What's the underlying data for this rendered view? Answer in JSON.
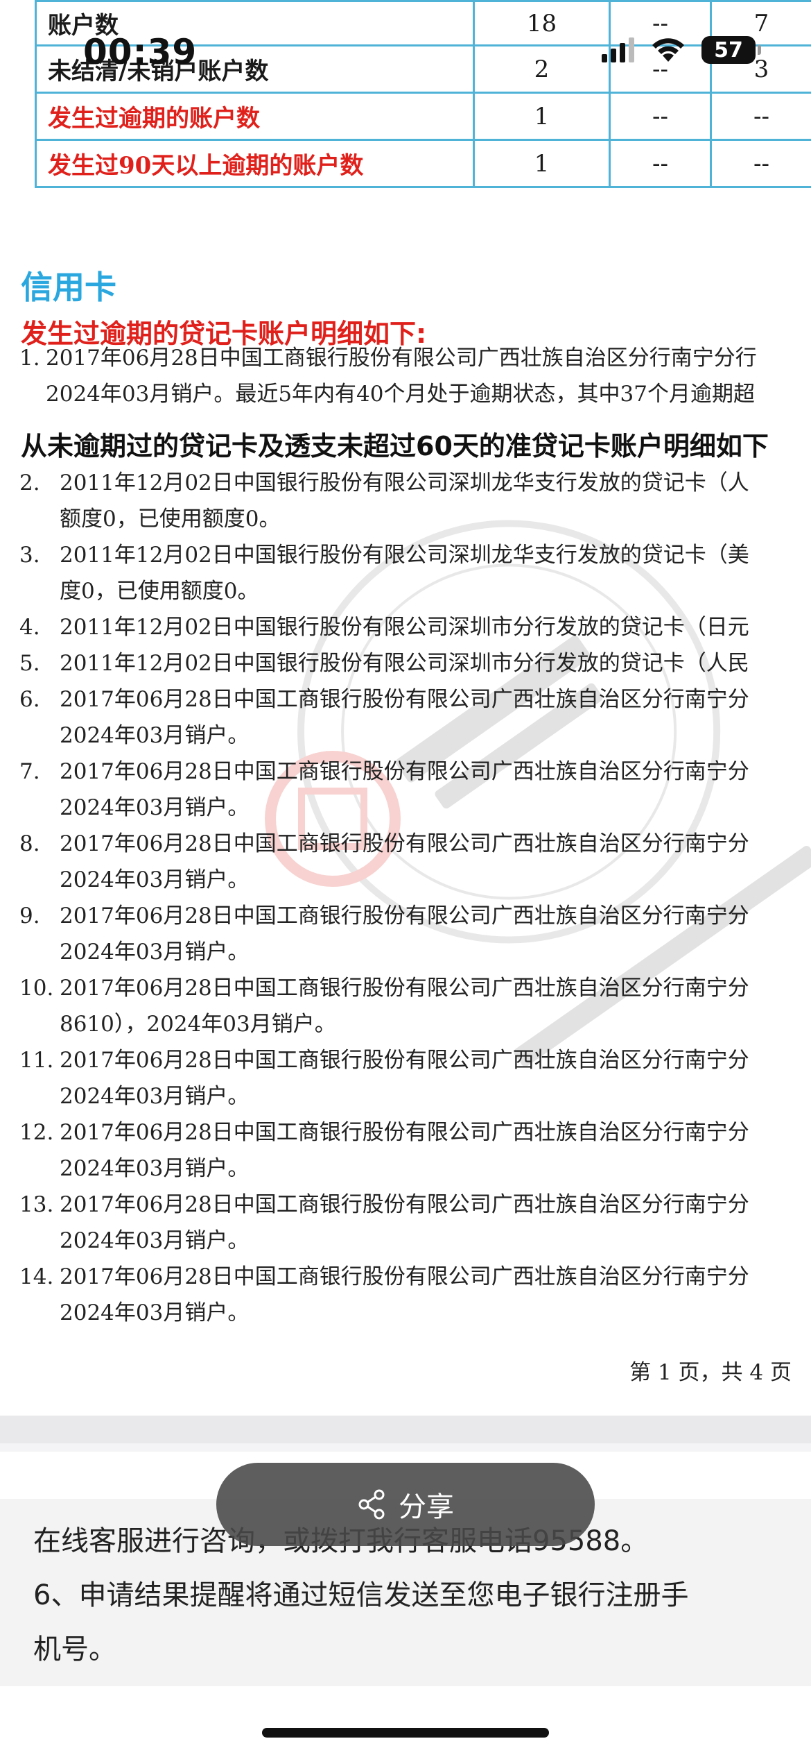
{
  "status_bar": {
    "time": "00:39",
    "battery": "57"
  },
  "summary_table": {
    "rows": [
      {
        "label": "账户数",
        "c1": "18",
        "c2": "--",
        "c3": "7",
        "red": false
      },
      {
        "label": "未结清/未销户账户数",
        "c1": "2",
        "c2": "--",
        "c3": "3",
        "red": false
      },
      {
        "label": "发生过逾期的账户数",
        "c1": "1",
        "c2": "--",
        "c3": "--",
        "red": true
      },
      {
        "label": "发生过90天以上逾期的账户数",
        "c1": "1",
        "c2": "--",
        "c3": "--",
        "red": true
      }
    ]
  },
  "section": {
    "title": "信用卡",
    "overdue_heading": "发生过逾期的贷记卡账户明细如下:",
    "clean_heading": "从未逾期过的贷记卡及透支未超过60天的准贷记卡账户明细如下"
  },
  "items": [
    {
      "no": "1.",
      "line1": "2017年06月28日中国工商银行股份有限公司广西壮族自治区分行南宁分行",
      "line2": "2024年03月销户。最近5年内有40个月处于逾期状态，其中37个月逾期超"
    },
    {
      "no": "2.",
      "line1": "2011年12月02日中国银行股份有限公司深圳龙华支行发放的贷记卡（人",
      "line2": "额度0，已使用额度0。"
    },
    {
      "no": "3.",
      "line1": "2011年12月02日中国银行股份有限公司深圳龙华支行发放的贷记卡（美",
      "line2": "度0，已使用额度0。"
    },
    {
      "no": "4.",
      "line1": "2011年12月02日中国银行股份有限公司深圳市分行发放的贷记卡（日元",
      "line2": ""
    },
    {
      "no": "5.",
      "line1": "2011年12月02日中国银行股份有限公司深圳市分行发放的贷记卡（人民",
      "line2": ""
    },
    {
      "no": "6.",
      "line1": "2017年06月28日中国工商银行股份有限公司广西壮族自治区分行南宁分",
      "line2": "2024年03月销户。"
    },
    {
      "no": "7.",
      "line1": "2017年06月28日中国工商银行股份有限公司广西壮族自治区分行南宁分",
      "line2": "2024年03月销户。"
    },
    {
      "no": "8.",
      "line1": "2017年06月28日中国工商银行股份有限公司广西壮族自治区分行南宁分",
      "line2": "2024年03月销户。"
    },
    {
      "no": "9.",
      "line1": "2017年06月28日中国工商银行股份有限公司广西壮族自治区分行南宁分",
      "line2": "2024年03月销户。"
    },
    {
      "no": "10.",
      "line1": "2017年06月28日中国工商银行股份有限公司广西壮族自治区分行南宁分",
      "line2": "8610），2024年03月销户。"
    },
    {
      "no": "11.",
      "line1": "2017年06月28日中国工商银行股份有限公司广西壮族自治区分行南宁分",
      "line2": "2024年03月销户。"
    },
    {
      "no": "12.",
      "line1": "2017年06月28日中国工商银行股份有限公司广西壮族自治区分行南宁分",
      "line2": "2024年03月销户。"
    },
    {
      "no": "13.",
      "line1": "2017年06月28日中国工商银行股份有限公司广西壮族自治区分行南宁分",
      "line2": "2024年03月销户。"
    },
    {
      "no": "14.",
      "line1": "2017年06月28日中国工商银行股份有限公司广西壮族自治区分行南宁分",
      "line2": "2024年03月销户。"
    }
  ],
  "page_footer": "第 1 页，共 4 页",
  "share": {
    "label": "分享",
    "icon": "share-icon"
  },
  "notice": {
    "line1": "在线客服进行咨询，或拨打我行客服电话95588。",
    "line2": "6、申请结果提醒将通过短信发送至您电子银行注册手",
    "line3": "机号。"
  },
  "colors": {
    "accent_blue": "#2aa7de",
    "alert_red": "#e0201b",
    "table_border": "#4fb3d8"
  }
}
